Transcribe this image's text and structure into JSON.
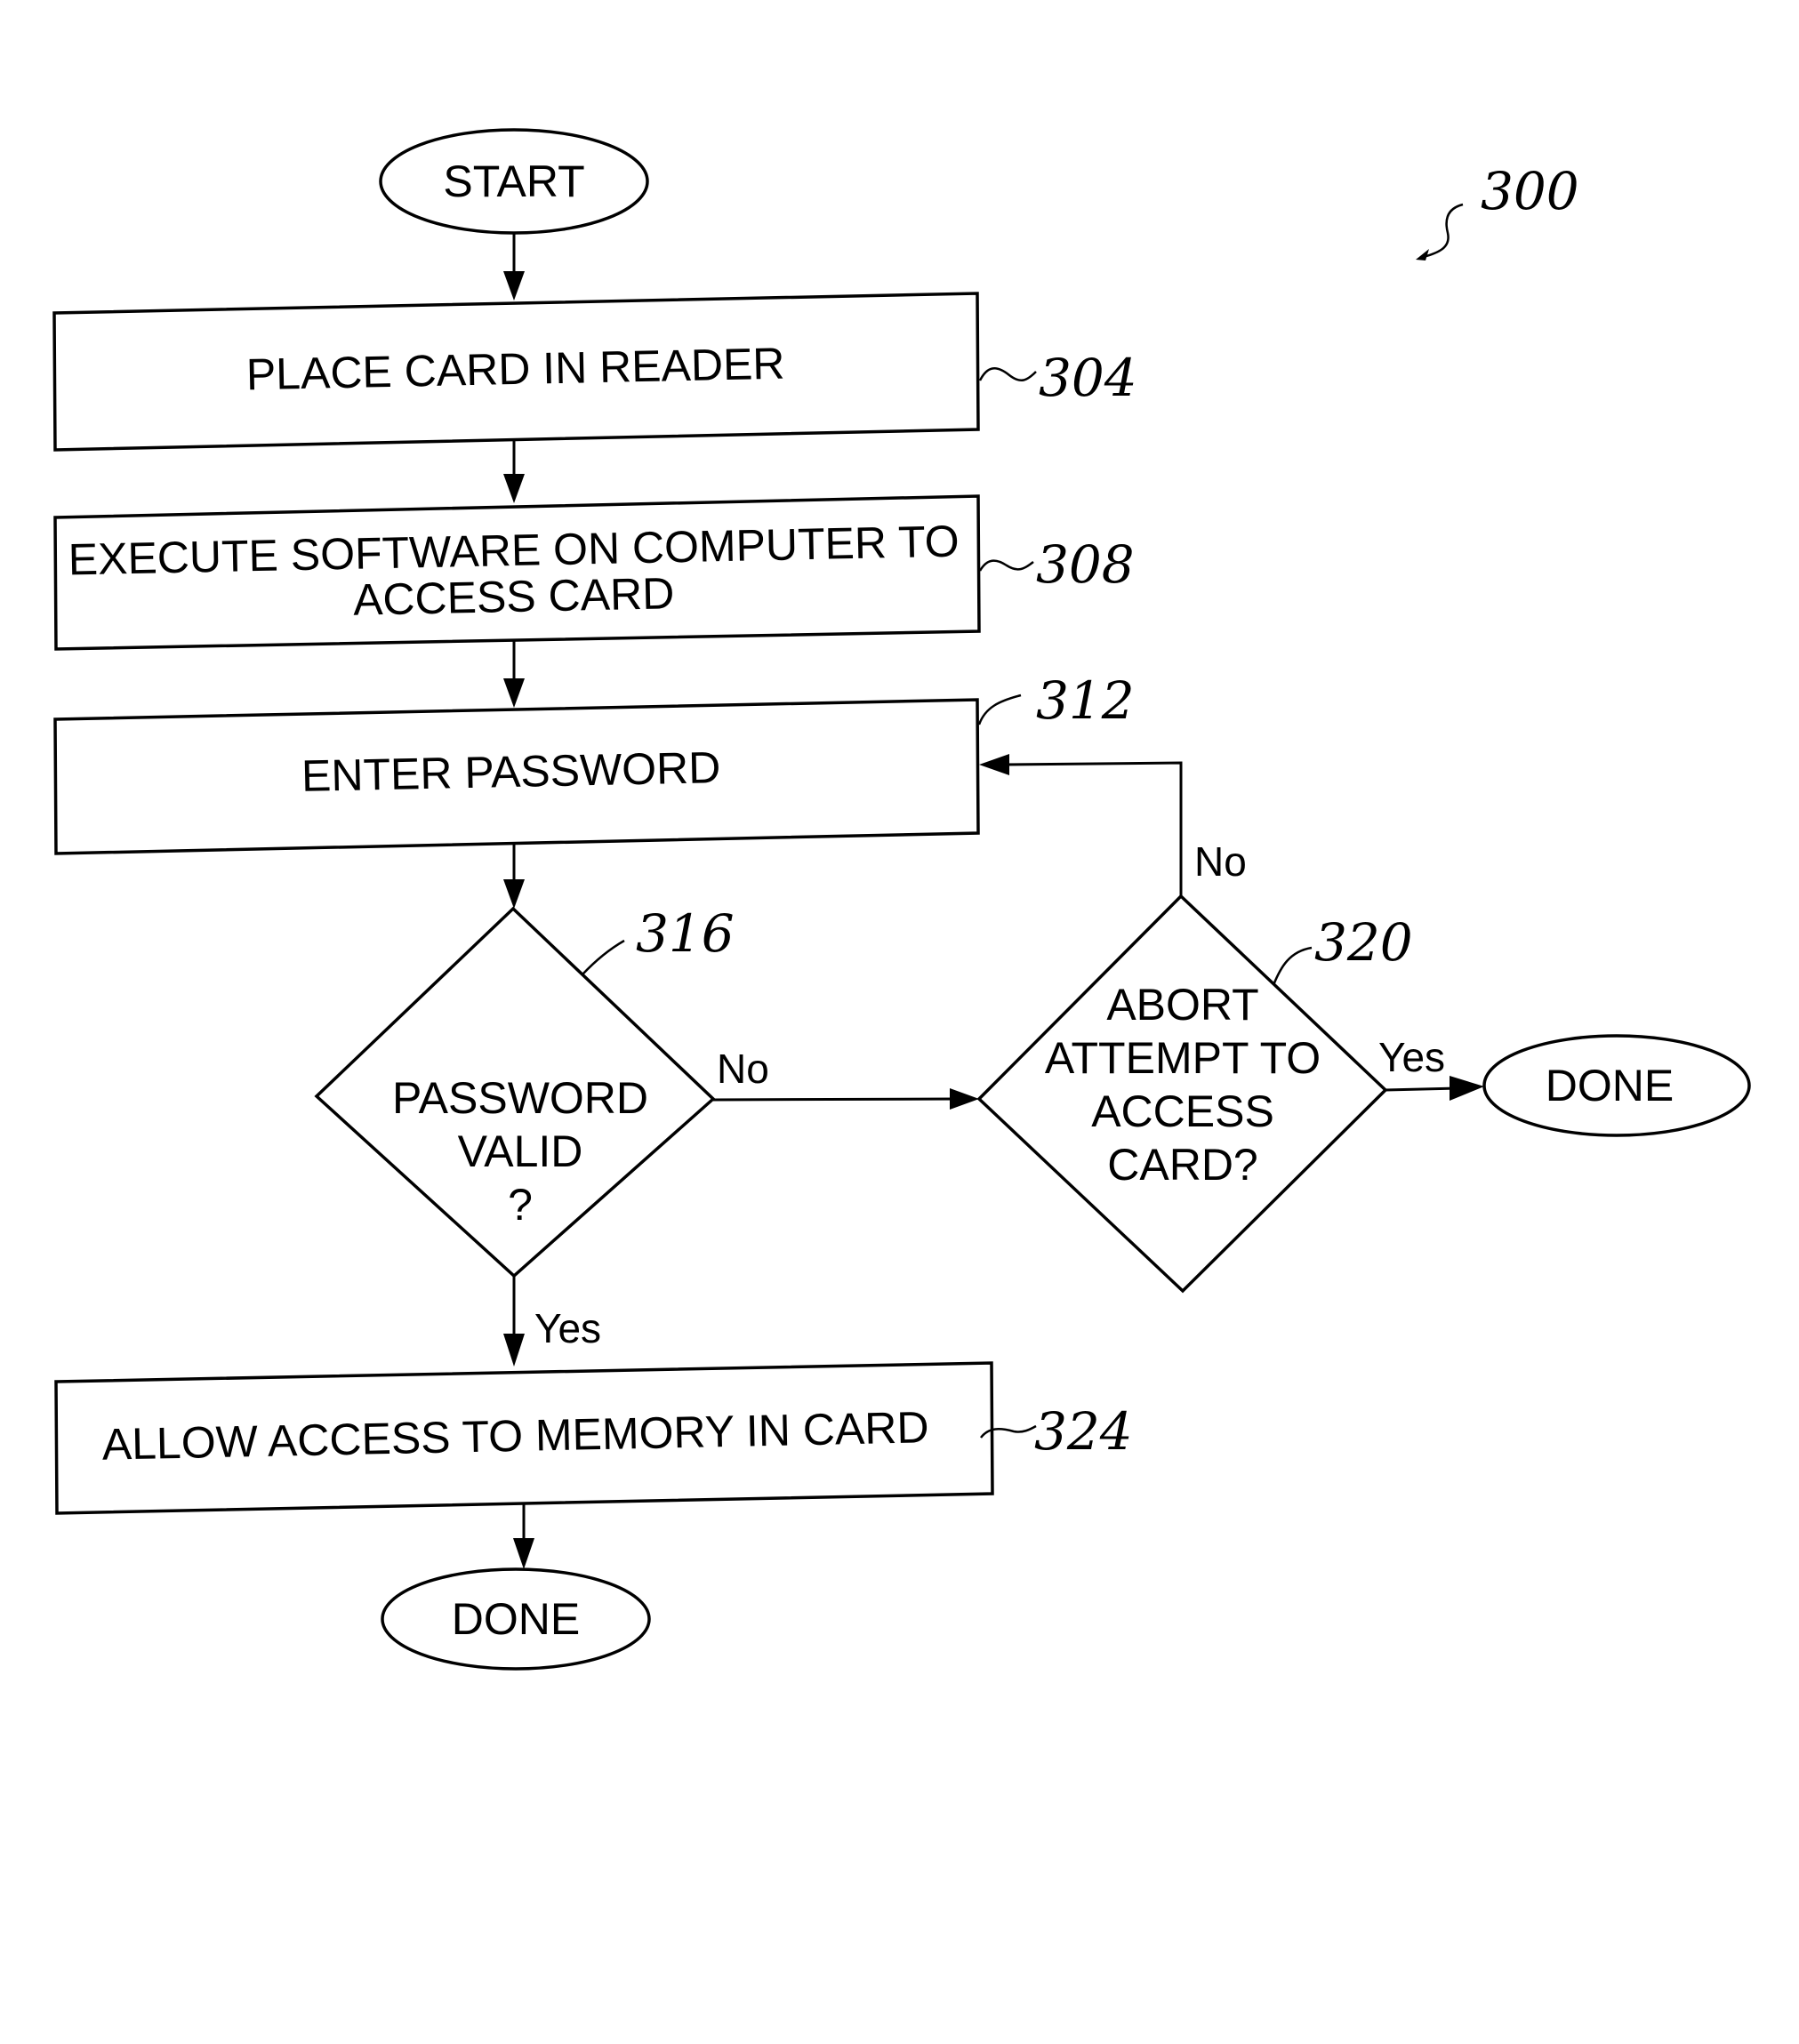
{
  "figure": {
    "number": "300",
    "nodes": [
      {
        "id": "start",
        "type": "terminal",
        "label": [
          "START"
        ]
      },
      {
        "id": "304",
        "type": "process",
        "label": [
          "PLACE CARD IN READER"
        ],
        "ref": "304"
      },
      {
        "id": "308",
        "type": "process",
        "label": [
          "EXECUTE SOFTWARE ON COMPUTER TO",
          "ACCESS CARD"
        ],
        "ref": "308"
      },
      {
        "id": "312",
        "type": "process",
        "label": [
          "ENTER PASSWORD"
        ],
        "ref": "312"
      },
      {
        "id": "316",
        "type": "decision",
        "label": [
          "PASSWORD",
          "VALID",
          "?"
        ],
        "ref": "316"
      },
      {
        "id": "320",
        "type": "decision",
        "label": [
          "ABORT",
          "ATTEMPT TO",
          "ACCESS",
          "CARD?"
        ],
        "ref": "320"
      },
      {
        "id": "done_right",
        "type": "terminal",
        "label": [
          "DONE"
        ]
      },
      {
        "id": "324",
        "type": "process",
        "label": [
          "ALLOW ACCESS TO MEMORY IN CARD"
        ],
        "ref": "324"
      },
      {
        "id": "done_bottom",
        "type": "terminal",
        "label": [
          "DONE"
        ]
      }
    ],
    "edges": [
      {
        "from": "start",
        "to": "304",
        "label": ""
      },
      {
        "from": "304",
        "to": "308",
        "label": ""
      },
      {
        "from": "308",
        "to": "312",
        "label": ""
      },
      {
        "from": "312",
        "to": "316",
        "label": ""
      },
      {
        "from": "316",
        "to": "320",
        "label": "No"
      },
      {
        "from": "320",
        "to": "312",
        "label": "No"
      },
      {
        "from": "320",
        "to": "done_right",
        "label": "Yes"
      },
      {
        "from": "316",
        "to": "324",
        "label": "Yes"
      },
      {
        "from": "324",
        "to": "done_bottom",
        "label": ""
      }
    ]
  }
}
